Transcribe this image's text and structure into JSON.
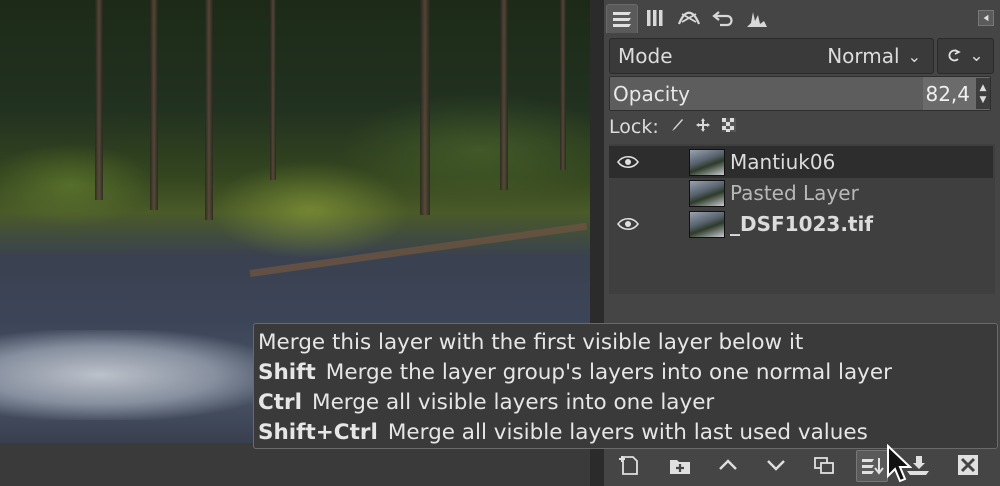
{
  "dock": {
    "tabs": [
      {
        "name": "layers-icon"
      },
      {
        "name": "channels-icon"
      },
      {
        "name": "paths-icon"
      },
      {
        "name": "undo-history-icon"
      },
      {
        "name": "histogram-icon"
      }
    ],
    "mode": {
      "label": "Mode",
      "value": "Normal"
    },
    "opacity": {
      "label": "Opacity",
      "value": "82,4",
      "fraction": 0.824
    },
    "lock": {
      "label": "Lock:"
    },
    "layers": [
      {
        "name": "Mantiuk06",
        "visible": true,
        "selected": true,
        "style": "normal"
      },
      {
        "name": "Pasted Layer",
        "visible": false,
        "selected": false,
        "style": "dim"
      },
      {
        "name": "_DSF1023.tif",
        "visible": true,
        "selected": false,
        "style": "bold"
      }
    ],
    "bottom_buttons": [
      "new-layer-icon",
      "new-layer-group-icon",
      "raise-layer-icon",
      "lower-layer-icon",
      "duplicate-layer-icon",
      "merge-down-icon",
      "anchor-layer-icon",
      "delete-layer-icon"
    ]
  },
  "tooltip": {
    "line1": "Merge this layer with the first visible layer below it",
    "line2_key": "Shift",
    "line2_text": "Merge the layer group's layers into one normal layer",
    "line3_key": "Ctrl",
    "line3_text": "Merge all visible layers into one layer",
    "line4_key": "Shift+Ctrl",
    "line4_text": "Merge all visible layers with last used values"
  }
}
